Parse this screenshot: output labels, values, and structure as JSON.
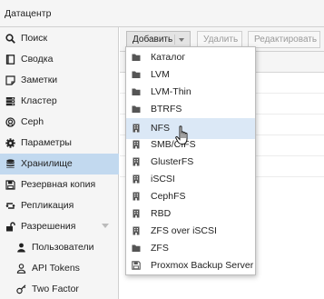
{
  "window": {
    "title": "Датацентр"
  },
  "sidebar": {
    "items": [
      {
        "label": "Поиск",
        "icon": "search-icon"
      },
      {
        "label": "Сводка",
        "icon": "book-icon"
      },
      {
        "label": "Заметки",
        "icon": "note-icon"
      },
      {
        "label": "Кластер",
        "icon": "server-icon"
      },
      {
        "label": "Ceph",
        "icon": "ceph-icon"
      },
      {
        "label": "Параметры",
        "icon": "gear-icon"
      },
      {
        "label": "Хранилище",
        "icon": "database-icon",
        "active": true
      },
      {
        "label": "Резервная копия",
        "icon": "floppy-icon"
      },
      {
        "label": "Репликация",
        "icon": "retweet-icon"
      },
      {
        "label": "Разрешения",
        "icon": "unlock-icon",
        "expandable": true
      },
      {
        "label": "Пользователи",
        "icon": "user-icon",
        "sub": true
      },
      {
        "label": "API Tokens",
        "icon": "user-outline-icon",
        "sub": true
      },
      {
        "label": "Two Factor",
        "icon": "key-icon",
        "sub": true
      }
    ]
  },
  "toolbar": {
    "add_label": "Добавить",
    "delete_label": "Удалить",
    "edit_label": "Редактировать"
  },
  "add_menu": {
    "items": [
      {
        "label": "Каталог",
        "icon": "folder-icon"
      },
      {
        "label": "LVM",
        "icon": "folder-icon"
      },
      {
        "label": "LVM-Thin",
        "icon": "folder-icon"
      },
      {
        "label": "BTRFS",
        "icon": "folder-icon"
      },
      {
        "label": "NFS",
        "icon": "building-icon",
        "hovered": true
      },
      {
        "label": "SMB/CIFS",
        "icon": "building-icon"
      },
      {
        "label": "GlusterFS",
        "icon": "building-icon"
      },
      {
        "label": "iSCSI",
        "icon": "building-icon"
      },
      {
        "label": "CephFS",
        "icon": "building-icon"
      },
      {
        "label": "RBD",
        "icon": "building-icon"
      },
      {
        "label": "ZFS over iSCSI",
        "icon": "building-icon"
      },
      {
        "label": "ZFS",
        "icon": "folder-icon"
      },
      {
        "label": "Proxmox Backup Server",
        "icon": "floppy-icon"
      }
    ]
  }
}
